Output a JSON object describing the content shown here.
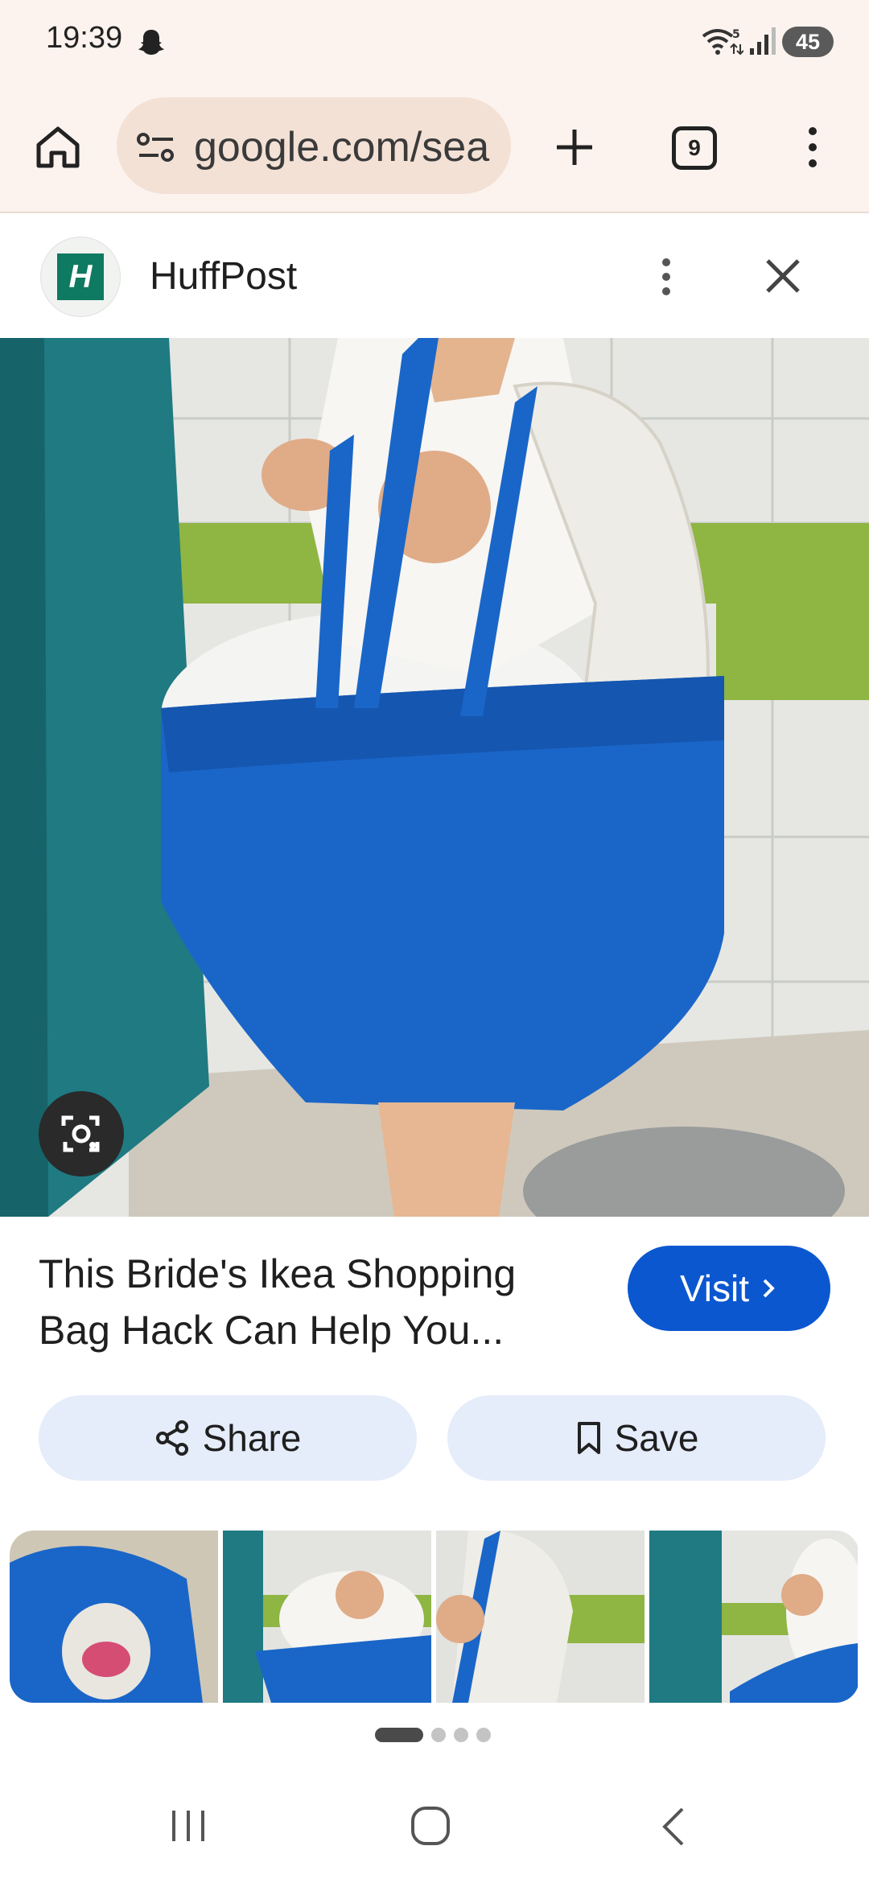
{
  "status_bar": {
    "time": "19:39",
    "battery": "45",
    "icons": [
      "snapchat-ghost-icon",
      "wifi-icon",
      "signal-icon"
    ]
  },
  "browser": {
    "url": "google.com/sea",
    "tab_count": "9"
  },
  "source": {
    "logo_letter": "H",
    "name": "HuffPost"
  },
  "result": {
    "title": "This Bride's Ikea Shopping Bag Hack Can Help You...",
    "visit_label": "Visit",
    "share_label": "Share",
    "save_label": "Save"
  },
  "related": {
    "thumbnail_count": 4,
    "pager": {
      "current": 1,
      "total": 4
    }
  },
  "colors": {
    "toolbar_bg": "#fcf3ee",
    "url_bar_bg": "#f3e1d6",
    "visit_bg": "#0b57d0",
    "chip_bg": "#e5ecfa",
    "ikea_blue": "#1a66c8",
    "stall_teal": "#1f7a82"
  }
}
